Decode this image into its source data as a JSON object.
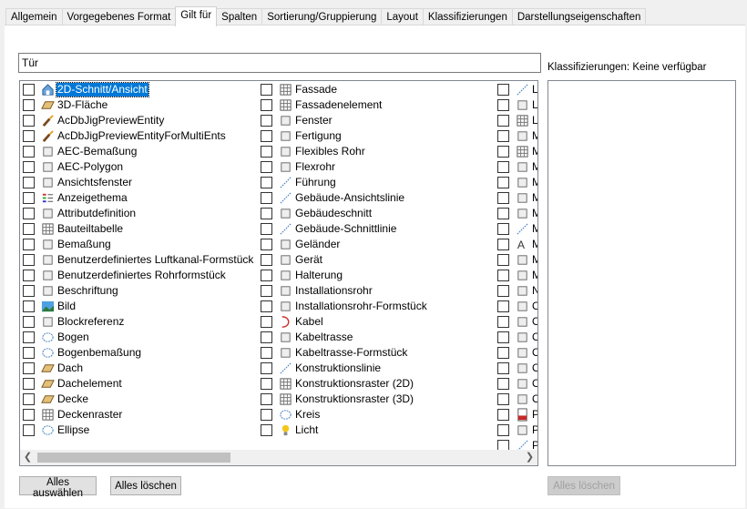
{
  "tabs": [
    "Allgemein",
    "Vorgegebenes Format",
    "Gilt für",
    "Spalten",
    "Sortierung/Gruppierung",
    "Layout",
    "Klassifizierungen",
    "Darstellungseigenschaften"
  ],
  "name_value": "Tür",
  "col1": [
    {
      "label": "2D-Schnitt/Ansicht",
      "icon": "house-section-icon"
    },
    {
      "label": "3D-Fläche",
      "icon": "3d-face-icon"
    },
    {
      "label": "AcDbJigPreviewEntity",
      "icon": "brush-icon"
    },
    {
      "label": "AcDbJigPreviewEntityForMultiEnts",
      "icon": "brush-icon"
    },
    {
      "label": "AEC-Bemaßung",
      "icon": "aec-dimension-icon"
    },
    {
      "label": "AEC-Polygon",
      "icon": "polygon-icon"
    },
    {
      "label": "Ansichtsfenster",
      "icon": "viewport-icon"
    },
    {
      "label": "Anzeigethema",
      "icon": "display-theme-icon"
    },
    {
      "label": "Attributdefinition",
      "icon": "tag-icon"
    },
    {
      "label": "Bauteiltabelle",
      "icon": "table-icon"
    },
    {
      "label": "Bemaßung",
      "icon": "dimension-icon"
    },
    {
      "label": "Benutzerdefiniertes Luftkanal-Formstück",
      "icon": "duct-fitting-icon"
    },
    {
      "label": "Benutzerdefiniertes Rohrformstück",
      "icon": "pipe-fitting-icon"
    },
    {
      "label": "Beschriftung",
      "icon": "label-icon"
    },
    {
      "label": "Bild",
      "icon": "image-icon"
    },
    {
      "label": "Blockreferenz",
      "icon": "block-reference-icon"
    },
    {
      "label": "Bogen",
      "icon": "arc-icon"
    },
    {
      "label": "Bogenbemaßung",
      "icon": "arc-dimension-icon"
    },
    {
      "label": "Dach",
      "icon": "roof-icon"
    },
    {
      "label": "Dachelement",
      "icon": "roof-slab-icon"
    },
    {
      "label": "Decke",
      "icon": "slab-icon"
    },
    {
      "label": "Deckenraster",
      "icon": "ceiling-grid-icon"
    },
    {
      "label": "Ellipse",
      "icon": "ellipse-icon"
    }
  ],
  "col2": [
    {
      "label": "Fassade",
      "icon": "curtain-wall-icon"
    },
    {
      "label": "Fassadenelement",
      "icon": "curtain-wall-unit-icon"
    },
    {
      "label": "Fenster",
      "icon": "window-icon"
    },
    {
      "label": "Fertigung",
      "icon": "fabrication-icon"
    },
    {
      "label": "Flexibles Rohr",
      "icon": "flex-pipe-icon"
    },
    {
      "label": "Flexrohr",
      "icon": "flex-duct-icon"
    },
    {
      "label": "Führung",
      "icon": "leader-icon"
    },
    {
      "label": "Gebäude-Ansichtslinie",
      "icon": "elevation-line-icon"
    },
    {
      "label": "Gebäudeschnitt",
      "icon": "building-section-icon"
    },
    {
      "label": "Gebäude-Schnittlinie",
      "icon": "section-line-icon"
    },
    {
      "label": "Geländer",
      "icon": "railing-icon"
    },
    {
      "label": "Gerät",
      "icon": "device-icon"
    },
    {
      "label": "Halterung",
      "icon": "hanger-icon"
    },
    {
      "label": "Installationsrohr",
      "icon": "conduit-icon"
    },
    {
      "label": "Installationsrohr-Formstück",
      "icon": "conduit-fitting-icon"
    },
    {
      "label": "Kabel",
      "icon": "wire-icon"
    },
    {
      "label": "Kabeltrasse",
      "icon": "cable-tray-icon"
    },
    {
      "label": "Kabeltrasse-Formstück",
      "icon": "cable-tray-fitting-icon"
    },
    {
      "label": "Konstruktionslinie",
      "icon": "construction-line-icon"
    },
    {
      "label": "Konstruktionsraster (2D)",
      "icon": "grid-2d-icon"
    },
    {
      "label": "Konstruktionsraster (3D)",
      "icon": "grid-3d-icon"
    },
    {
      "label": "Kreis",
      "icon": "circle-icon"
    },
    {
      "label": "Licht",
      "icon": "light-bulb-icon"
    }
  ],
  "col3": [
    {
      "label": "L",
      "icon": "line-icon"
    },
    {
      "label": "L",
      "icon": "layout-curve-icon"
    },
    {
      "label": "L",
      "icon": "layout-grid-icon"
    },
    {
      "label": "M",
      "icon": "mass-element-icon"
    },
    {
      "label": "M",
      "icon": "mask-block-icon"
    },
    {
      "label": "M",
      "icon": "mask-icon"
    },
    {
      "label": "M",
      "icon": "member-icon"
    },
    {
      "label": "M",
      "icon": "multi-view-block-icon"
    },
    {
      "label": "M",
      "icon": "mvpart-icon"
    },
    {
      "label": "M",
      "icon": "mline-icon"
    },
    {
      "label": "M",
      "icon": "mtext-icon"
    },
    {
      "label": "M",
      "icon": "mesh-icon"
    },
    {
      "label": "M",
      "icon": "mesh-group-icon"
    },
    {
      "label": "N",
      "icon": "nurbs-icon"
    },
    {
      "label": "O",
      "icon": "opening-icon"
    },
    {
      "label": "O",
      "icon": "object-icon"
    },
    {
      "label": "O",
      "icon": "ole-icon"
    },
    {
      "label": "O",
      "icon": "open-duct-icon"
    },
    {
      "label": "O",
      "icon": "open-pipe-icon"
    },
    {
      "label": "O",
      "icon": "opening-2-icon"
    },
    {
      "label": "O",
      "icon": "pipe-part-icon"
    },
    {
      "label": "P",
      "icon": "pdf-underlay-icon"
    },
    {
      "label": "P",
      "icon": "point-icon"
    },
    {
      "label": "P",
      "icon": "polyline-icon"
    }
  ],
  "classifications_label": "Klassifizierungen: Keine verfügbar",
  "buttons": {
    "select_all": "Alles auswählen",
    "clear_all": "Alles löschen",
    "clear_all_right": "Alles löschen"
  }
}
